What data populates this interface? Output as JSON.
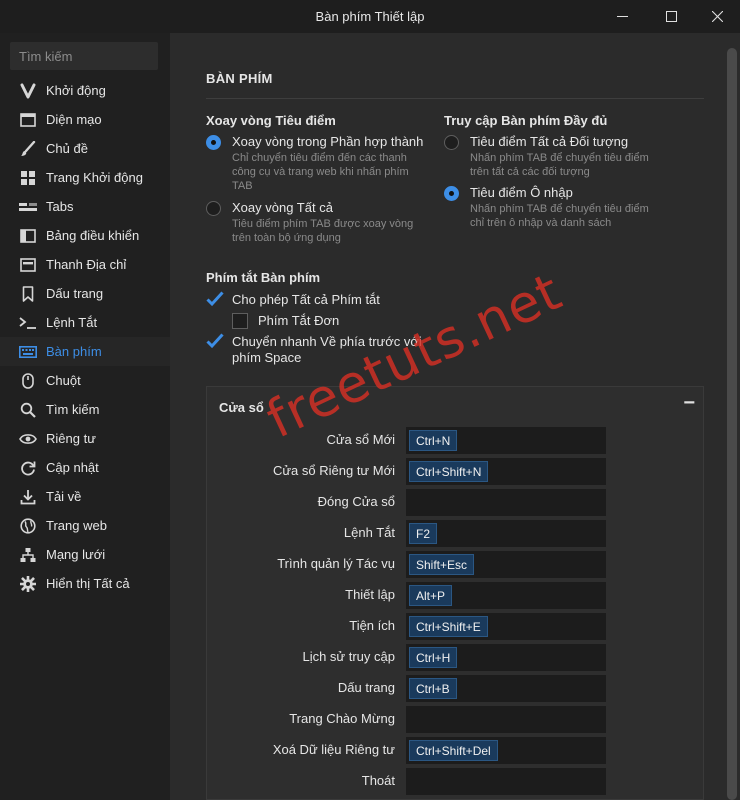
{
  "window": {
    "title": "Bàn phím Thiết lập"
  },
  "sidebar": {
    "search_placeholder": "Tìm kiếm",
    "items": [
      {
        "label": "Khởi động",
        "icon": "vivaldi-icon"
      },
      {
        "label": "Diện mạo",
        "icon": "window-icon"
      },
      {
        "label": "Chủ đề",
        "icon": "brush-icon"
      },
      {
        "label": "Trang Khởi động",
        "icon": "grid-icon"
      },
      {
        "label": "Tabs",
        "icon": "tabs-icon"
      },
      {
        "label": "Bảng điều khiển",
        "icon": "panel-icon"
      },
      {
        "label": "Thanh Địa chỉ",
        "icon": "address-bar-icon"
      },
      {
        "label": "Dấu trang",
        "icon": "bookmark-icon"
      },
      {
        "label": "Lệnh Tắt",
        "icon": "command-icon"
      },
      {
        "label": "Bàn phím",
        "icon": "keyboard-icon",
        "active": true
      },
      {
        "label": "Chuột",
        "icon": "mouse-icon"
      },
      {
        "label": "Tìm kiếm",
        "icon": "search-icon"
      },
      {
        "label": "Riêng tư",
        "icon": "eye-icon"
      },
      {
        "label": "Cập nhật",
        "icon": "refresh-icon"
      },
      {
        "label": "Tải về",
        "icon": "download-icon"
      },
      {
        "label": "Trang web",
        "icon": "globe-icon"
      },
      {
        "label": "Mạng lưới",
        "icon": "network-icon"
      },
      {
        "label": "Hiển thị Tất cả",
        "icon": "gear-icon"
      }
    ]
  },
  "main": {
    "heading": "BÀN PHÍM",
    "focus_cycle": {
      "title": "Xoay vòng Tiêu điểm",
      "options": [
        {
          "label": "Xoay vòng trong Phần hợp thành",
          "desc": [
            "Chỉ chuyển tiêu điểm đến các thanh",
            "công cụ và trang web khi nhấn phím",
            "TAB"
          ],
          "selected": true
        },
        {
          "label": "Xoay vòng Tất cả",
          "desc": [
            "Tiêu điểm phím TAB được xoay vòng",
            "trên toàn bộ ứng dụng"
          ],
          "selected": false
        }
      ]
    },
    "full_access": {
      "title": "Truy cập Bàn phím Đầy đủ",
      "options": [
        {
          "label": "Tiêu điểm Tất cả Đối tượng",
          "desc": [
            "Nhấn phím TAB để chuyển tiêu điểm",
            "trên tất cả các đối tượng"
          ],
          "selected": false
        },
        {
          "label": "Tiêu điểm Ô nhập",
          "desc": [
            "Nhấn phím TAB để chuyển tiêu điểm",
            "chỉ trên ô nhập và danh sách"
          ],
          "selected": true
        }
      ]
    },
    "shortcuts": {
      "title": "Phím tắt Bàn phím",
      "allow_all": {
        "label": "Cho phép Tất cả Phím tắt",
        "checked": true
      },
      "single_key": {
        "label": "Phím Tắt Đơn",
        "checked": false
      },
      "space_forward": {
        "label_lines": [
          "Chuyển nhanh Về phía trước với",
          "phím Space"
        ],
        "checked": true
      }
    },
    "window_panel": {
      "title": "Cửa sổ",
      "collapse_symbol": "−",
      "rows": [
        {
          "label": "Cửa sổ Mới",
          "shortcut": "Ctrl+N"
        },
        {
          "label": "Cửa sổ Riêng tư Mới",
          "shortcut": "Ctrl+Shift+N"
        },
        {
          "label": "Đóng Cửa sổ",
          "shortcut": ""
        },
        {
          "label": "Lệnh Tắt",
          "shortcut": "F2"
        },
        {
          "label": "Trình quản lý Tác vụ",
          "shortcut": "Shift+Esc"
        },
        {
          "label": "Thiết lập",
          "shortcut": "Alt+P"
        },
        {
          "label": "Tiện ích",
          "shortcut": "Ctrl+Shift+E"
        },
        {
          "label": "Lịch sử truy cập",
          "shortcut": "Ctrl+H"
        },
        {
          "label": "Dấu trang",
          "shortcut": "Ctrl+B"
        },
        {
          "label": "Trang Chào Mừng",
          "shortcut": ""
        },
        {
          "label": "Xoá Dữ liệu Riêng tư",
          "shortcut": "Ctrl+Shift+Del"
        },
        {
          "label": "Thoát",
          "shortcut": ""
        }
      ]
    }
  },
  "watermark": "freetuts.net",
  "colors": {
    "accent": "#3d8ee6",
    "sidebar_bg": "#202020",
    "content_bg": "#2b2b2b",
    "watermark": "#d63024"
  }
}
